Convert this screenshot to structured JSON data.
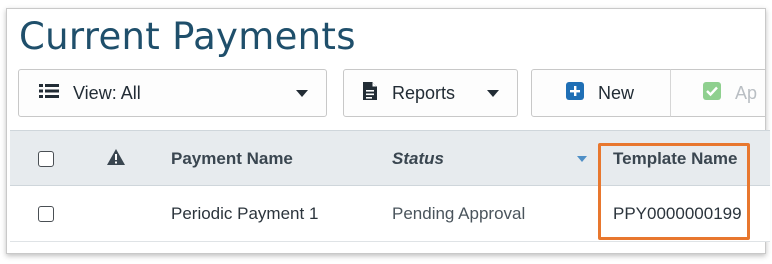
{
  "page": {
    "title": "Current Payments"
  },
  "toolbar": {
    "view_label": "View: All",
    "reports_label": "Reports",
    "new_label": "New",
    "approve_label": "Ap"
  },
  "table": {
    "columns": [
      "Payment Name",
      "Status",
      "Template Name"
    ],
    "rows": [
      {
        "payment_name": "Periodic Payment 1",
        "status": "Pending Approval",
        "template_name": "PPY0000000199"
      }
    ]
  },
  "colors": {
    "title": "#1f4f6b",
    "header_bg": "#e7ebee",
    "new_icon": "#1f6fb5",
    "approve_icon": "#8fd08f",
    "highlight": "#e8772e",
    "sort_caret": "#4f8fc6"
  },
  "icons": {
    "view": "list-icon",
    "reports": "document-icon",
    "new": "plus-square-icon",
    "approve": "check-square-icon",
    "alert_column": "warning-triangle-icon"
  }
}
